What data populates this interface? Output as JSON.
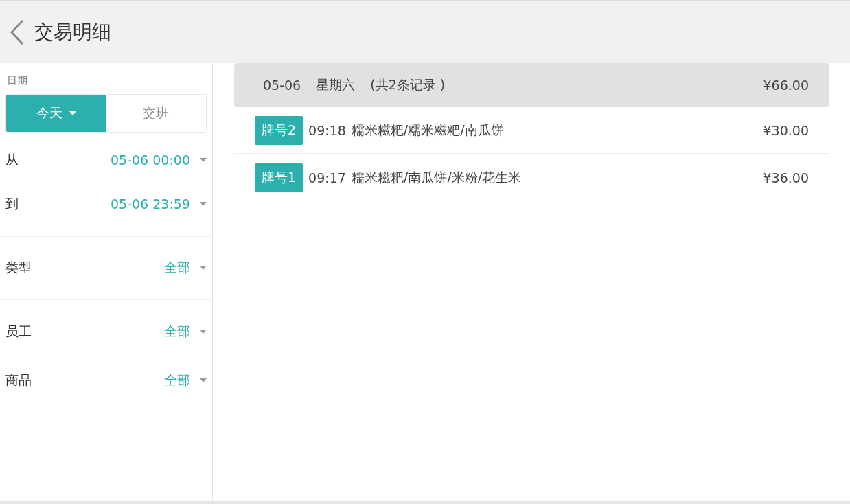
{
  "header": {
    "title": "交易明细"
  },
  "sidebar": {
    "date_label": "日期",
    "tabs": [
      {
        "label": "今天",
        "selected": true,
        "dropdown": true
      },
      {
        "label": "交班",
        "selected": false,
        "dropdown": false
      }
    ],
    "filter_groups": [
      {
        "filters": [
          {
            "label": "从",
            "value": "05-06 00:00"
          },
          {
            "label": "到",
            "value": "05-06 23:59"
          }
        ]
      },
      {
        "filters": [
          {
            "label": "类型",
            "value": "全部"
          }
        ]
      },
      {
        "filters": [
          {
            "label": "员工",
            "value": "全部"
          },
          {
            "label": "商品",
            "value": "全部"
          }
        ]
      }
    ]
  },
  "day_groups": [
    {
      "date": "05-06",
      "weekday": "星期六",
      "count": "(共2条记录 )",
      "total": "¥66.00",
      "records": [
        {
          "tag": "牌号2",
          "time": "09:18",
          "items": "糯米糍粑/糯米糍粑/南瓜饼",
          "amount": "¥30.00"
        },
        {
          "tag": "牌号1",
          "time": "09:17",
          "items": "糯米糍粑/南瓜饼/米粉/花生米",
          "amount": "¥36.00"
        }
      ]
    }
  ]
}
